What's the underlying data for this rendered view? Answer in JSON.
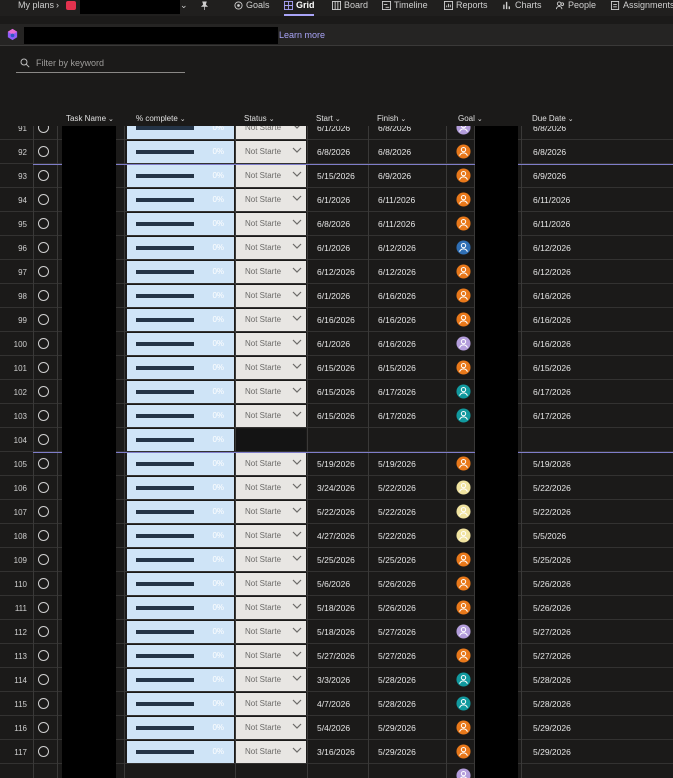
{
  "nav": {
    "my_plans": "My plans",
    "tabs": [
      {
        "label": "Goals",
        "icon": "goals-icon"
      },
      {
        "label": "Grid",
        "icon": "grid-icon",
        "selected": true
      },
      {
        "label": "Board",
        "icon": "board-icon"
      },
      {
        "label": "Timeline",
        "icon": "timeline-icon"
      },
      {
        "label": "Reports",
        "icon": "reports-icon"
      },
      {
        "label": "Charts",
        "icon": "charts-icon"
      },
      {
        "label": "People",
        "icon": "people-icon"
      },
      {
        "label": "Assignments",
        "icon": "assignments-icon"
      }
    ]
  },
  "banner": {
    "learn_more": "Learn more"
  },
  "filter": {
    "placeholder": "Filter by keyword"
  },
  "columns": {
    "task_name": "Task Name",
    "percent_complete": "% complete",
    "status": "Status",
    "start": "Start",
    "finish": "Finish",
    "goal": "Goal",
    "due_date": "Due Date"
  },
  "colors": {
    "accent": "#a9a4f7",
    "goal_orange": "#e8781a",
    "goal_purple": "#b39ddb",
    "goal_teal": "#11999e",
    "goal_blue": "#2f6fb5",
    "goal_yellow": "#f0e3a0"
  },
  "rows": [
    {
      "num": "91",
      "pct": "0%",
      "status": "Not Starte",
      "start": "6/1/2026",
      "finish": "6/8/2026",
      "goal": "purple",
      "due": "6/8/2026"
    },
    {
      "num": "92",
      "pct": "0%",
      "status": "Not Starte",
      "start": "6/8/2026",
      "finish": "6/8/2026",
      "goal": "orange",
      "due": "6/8/2026"
    },
    {
      "num": "93",
      "pct": "0%",
      "status": "Not Starte",
      "start": "5/15/2026",
      "finish": "6/9/2026",
      "goal": "orange",
      "due": "6/9/2026"
    },
    {
      "num": "94",
      "pct": "0%",
      "status": "Not Starte",
      "start": "6/1/2026",
      "finish": "6/11/2026",
      "goal": "orange",
      "due": "6/11/2026"
    },
    {
      "num": "95",
      "pct": "0%",
      "status": "Not Starte",
      "start": "6/8/2026",
      "finish": "6/11/2026",
      "goal": "orange",
      "due": "6/11/2026"
    },
    {
      "num": "96",
      "pct": "0%",
      "status": "Not Starte",
      "start": "6/1/2026",
      "finish": "6/12/2026",
      "goal": "blue",
      "due": "6/12/2026"
    },
    {
      "num": "97",
      "pct": "0%",
      "status": "Not Starte",
      "start": "6/12/2026",
      "finish": "6/12/2026",
      "goal": "orange",
      "due": "6/12/2026"
    },
    {
      "num": "98",
      "pct": "0%",
      "status": "Not Starte",
      "start": "6/1/2026",
      "finish": "6/16/2026",
      "goal": "orange",
      "due": "6/16/2026"
    },
    {
      "num": "99",
      "pct": "0%",
      "status": "Not Starte",
      "start": "6/16/2026",
      "finish": "6/16/2026",
      "goal": "orange",
      "due": "6/16/2026"
    },
    {
      "num": "100",
      "pct": "0%",
      "status": "Not Starte",
      "start": "6/1/2026",
      "finish": "6/16/2026",
      "goal": "purple",
      "due": "6/16/2026"
    },
    {
      "num": "101",
      "pct": "0%",
      "status": "Not Starte",
      "start": "6/15/2026",
      "finish": "6/15/2026",
      "goal": "orange",
      "due": "6/15/2026"
    },
    {
      "num": "102",
      "pct": "0%",
      "status": "Not Starte",
      "start": "6/15/2026",
      "finish": "6/17/2026",
      "goal": "teal",
      "due": "6/17/2026"
    },
    {
      "num": "103",
      "pct": "0%",
      "status": "Not Starte",
      "start": "6/15/2026",
      "finish": "6/17/2026",
      "goal": "teal",
      "due": "6/17/2026"
    },
    {
      "num": "104",
      "pct": "0%",
      "status": "",
      "start": "",
      "finish": "",
      "goal": "",
      "due": ""
    },
    {
      "num": "105",
      "pct": "0%",
      "status": "Not Starte",
      "start": "5/19/2026",
      "finish": "5/19/2026",
      "goal": "orange",
      "due": "5/19/2026"
    },
    {
      "num": "106",
      "pct": "0%",
      "status": "Not Starte",
      "start": "3/24/2026",
      "finish": "5/22/2026",
      "goal": "yellow",
      "due": "5/22/2026"
    },
    {
      "num": "107",
      "pct": "0%",
      "status": "Not Starte",
      "start": "5/22/2026",
      "finish": "5/22/2026",
      "goal": "yellow",
      "due": "5/22/2026"
    },
    {
      "num": "108",
      "pct": "0%",
      "status": "Not Starte",
      "start": "4/27/2026",
      "finish": "5/22/2026",
      "goal": "yellow",
      "due": "5/5/2026"
    },
    {
      "num": "109",
      "pct": "0%",
      "status": "Not Starte",
      "start": "5/25/2026",
      "finish": "5/25/2026",
      "goal": "orange",
      "due": "5/25/2026"
    },
    {
      "num": "110",
      "pct": "0%",
      "status": "Not Starte",
      "start": "5/6/2026",
      "finish": "5/26/2026",
      "goal": "orange",
      "due": "5/26/2026"
    },
    {
      "num": "111",
      "pct": "0%",
      "status": "Not Starte",
      "start": "5/18/2026",
      "finish": "5/26/2026",
      "goal": "orange",
      "due": "5/26/2026"
    },
    {
      "num": "112",
      "pct": "0%",
      "status": "Not Starte",
      "start": "5/18/2026",
      "finish": "5/27/2026",
      "goal": "purple",
      "due": "5/27/2026"
    },
    {
      "num": "113",
      "pct": "0%",
      "status": "Not Starte",
      "start": "5/27/2026",
      "finish": "5/27/2026",
      "goal": "orange",
      "due": "5/27/2026"
    },
    {
      "num": "114",
      "pct": "0%",
      "status": "Not Starte",
      "start": "3/3/2026",
      "finish": "5/28/2026",
      "goal": "teal",
      "due": "5/28/2026"
    },
    {
      "num": "115",
      "pct": "0%",
      "status": "Not Starte",
      "start": "4/7/2026",
      "finish": "5/28/2026",
      "goal": "teal",
      "due": "5/28/2026"
    },
    {
      "num": "116",
      "pct": "0%",
      "status": "Not Starte",
      "start": "5/4/2026",
      "finish": "5/29/2026",
      "goal": "orange",
      "due": "5/29/2026"
    },
    {
      "num": "117",
      "pct": "0%",
      "status": "Not Starte",
      "start": "3/16/2026",
      "finish": "5/29/2026",
      "goal": "orange",
      "due": "5/29/2026"
    },
    {
      "num": "",
      "pct": "",
      "status": "",
      "start": "",
      "finish": "",
      "goal": "purple",
      "due": ""
    }
  ]
}
